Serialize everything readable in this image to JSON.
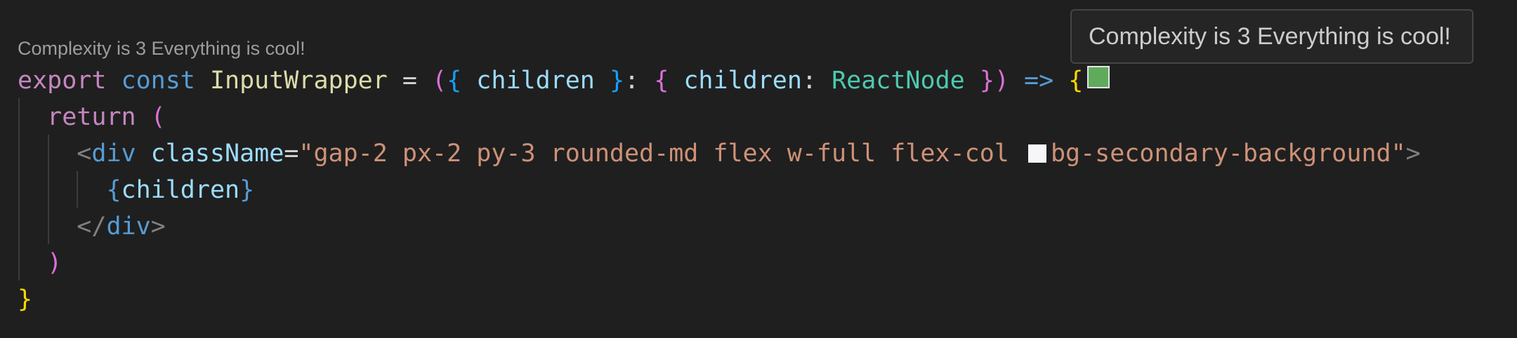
{
  "codelens": {
    "text": "Complexity is 3 Everything is cool!"
  },
  "tooltip": {
    "text": "Complexity is 3 Everything is cool!"
  },
  "colors": {
    "background": "#1f1f1f",
    "swatch_green": "#5fab5b",
    "swatch_white": "#f6f6f8"
  },
  "code": {
    "line1": {
      "export": "export",
      "const": "const",
      "name": "InputWrapper",
      "eq": "=",
      "paren_open": "(",
      "brace_open": "{",
      "children": "children",
      "brace_close": "}",
      "colon": ":",
      "type_brace_open": "{",
      "type_children": "children",
      "type_colon": ":",
      "react_node": "ReactNode",
      "type_brace_close": "}",
      "paren_close": ")",
      "arrow": "=>",
      "body_open": "{"
    },
    "line2": {
      "return": "return",
      "paren": "("
    },
    "line3": {
      "lt": "<",
      "div": "div",
      "attr": "className",
      "eq": "=",
      "class_value_1": "\"gap-2 px-2 py-3 rounded-md flex w-full flex-col",
      "class_value_2": "bg-secondary-background\"",
      "gt": ">"
    },
    "line4": {
      "open": "{",
      "children": "children",
      "close": "}"
    },
    "line5": {
      "lt": "</",
      "div": "div",
      "gt": ">"
    },
    "line6": {
      "paren": ")"
    },
    "line7": {
      "brace": "}"
    }
  }
}
